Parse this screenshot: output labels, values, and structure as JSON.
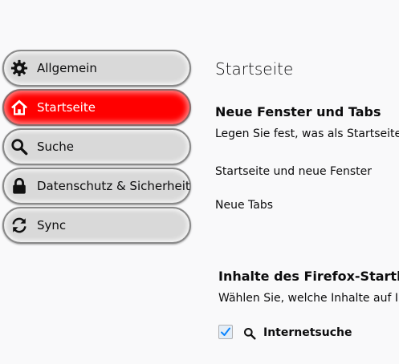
{
  "sidebar": {
    "items": [
      {
        "label": "Allgemein",
        "icon": "gear-icon"
      },
      {
        "label": "Startseite",
        "icon": "home-icon",
        "active": true
      },
      {
        "label": "Suche",
        "icon": "search-icon"
      },
      {
        "label": "Datenschutz & Sicherheit",
        "icon": "lock-icon"
      },
      {
        "label": "Sync",
        "icon": "sync-icon"
      }
    ]
  },
  "main": {
    "title": "Startseite",
    "new_windows_section": {
      "heading": "Neue Fenster und Tabs",
      "description": "Legen Sie fest, was als Startseite sc",
      "homepage_label": "Startseite und neue Fenster",
      "new_tabs_label": "Neue Tabs"
    },
    "home_content_section": {
      "heading": "Inhalte des Firefox-Startbildsc",
      "description": "Wählen Sie, welche Inhalte auf Ihre",
      "web_search": {
        "label": "Internetsuche",
        "checked": true
      }
    }
  },
  "colors": {
    "active_item": "#ff0000",
    "item_background": "#d9d9d9",
    "checkmark": "#0a84ff"
  }
}
